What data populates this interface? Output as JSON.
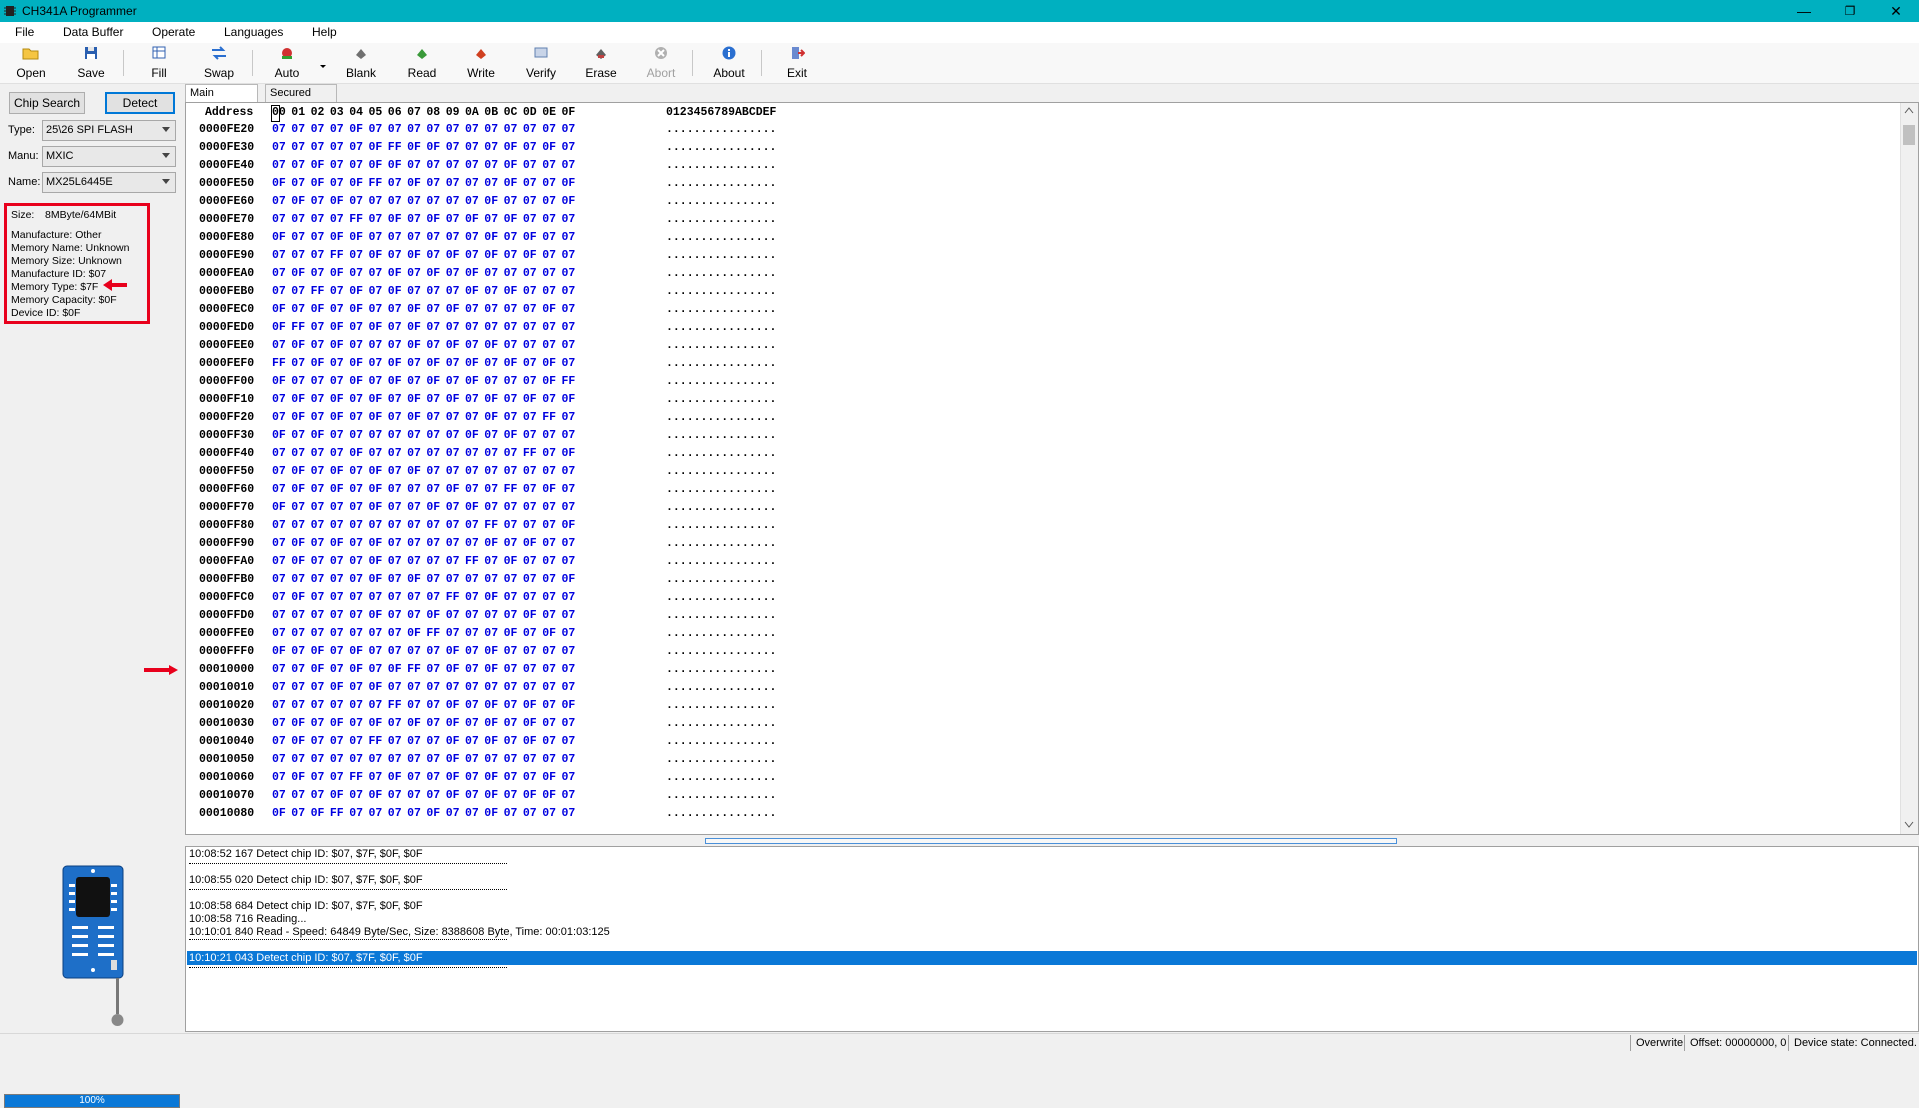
{
  "window": {
    "title": "CH341A Programmer",
    "minimize": "—",
    "maximize": "❐",
    "close": "✕"
  },
  "menu": [
    "File",
    "Data Buffer",
    "Operate",
    "Languages",
    "Help"
  ],
  "toolbar": {
    "open": "Open",
    "save": "Save",
    "fill": "Fill",
    "swap": "Swap",
    "auto": "Auto",
    "blank": "Blank",
    "read": "Read",
    "write": "Write",
    "verify": "Verify",
    "erase": "Erase",
    "abort": "Abort",
    "about": "About",
    "exit": "Exit"
  },
  "left": {
    "chip_search": "Chip Search",
    "detect": "Detect",
    "type_label": "Type:",
    "type_value": "25\\26 SPI FLASH",
    "manu_label": "Manu:",
    "manu_value": "MXIC",
    "name_label": "Name:",
    "name_value": "MX25L6445E",
    "info": {
      "size_label": "Size:",
      "size_value": "8MByte/64MBit",
      "manufacture": "Manufacture: Other",
      "memory_name": "Memory Name: Unknown",
      "memory_size": "Memory Size: Unknown",
      "manufacture_id": "Manufacture ID: $07",
      "memory_type": "Memory Type: $7F",
      "memory_capacity": "Memory Capacity: $0F",
      "device_id": "Device ID: $0F"
    },
    "progress": "100%",
    "progress_value": 100
  },
  "tabs": [
    "Main Memory",
    "Secured OTP"
  ],
  "hex": {
    "address_header": "Address",
    "columns": [
      "00",
      "01",
      "02",
      "03",
      "04",
      "05",
      "06",
      "07",
      "08",
      "09",
      "0A",
      "0B",
      "0C",
      "0D",
      "0E",
      "0F"
    ],
    "ascii_header": "0123456789ABCDEF",
    "ascii_row": "................",
    "rows": [
      {
        "addr": "0000FE20",
        "bytes": "07 07 07 07 0F 07 07 07 07 07 07 07 07 07 07 07"
      },
      {
        "addr": "0000FE30",
        "bytes": "07 07 07 07 07 0F FF 0F 0F 07 07 07 0F 07 0F 07"
      },
      {
        "addr": "0000FE40",
        "bytes": "07 07 0F 07 07 0F 0F 07 07 07 07 07 0F 07 07 07"
      },
      {
        "addr": "0000FE50",
        "bytes": "0F 07 0F 07 0F FF 07 0F 07 07 07 07 0F 07 07 0F"
      },
      {
        "addr": "0000FE60",
        "bytes": "07 0F 07 0F 07 07 07 07 07 07 07 0F 07 07 07 0F"
      },
      {
        "addr": "0000FE70",
        "bytes": "07 07 07 07 FF 07 0F 07 0F 07 0F 07 0F 07 07 07"
      },
      {
        "addr": "0000FE80",
        "bytes": "0F 07 07 0F 0F 07 07 07 07 07 07 0F 07 0F 07 07"
      },
      {
        "addr": "0000FE90",
        "bytes": "07 07 07 FF 07 0F 07 0F 07 0F 07 0F 07 0F 07 07"
      },
      {
        "addr": "0000FEA0",
        "bytes": "07 0F 07 0F 07 07 0F 07 0F 07 0F 07 07 07 07 07"
      },
      {
        "addr": "0000FEB0",
        "bytes": "07 07 FF 07 0F 07 0F 07 07 07 0F 07 0F 07 07 07"
      },
      {
        "addr": "0000FEC0",
        "bytes": "0F 07 0F 07 0F 07 07 0F 07 0F 07 07 07 07 0F 07"
      },
      {
        "addr": "0000FED0",
        "bytes": "0F FF 07 0F 07 0F 07 0F 07 07 07 07 07 07 07 07"
      },
      {
        "addr": "0000FEE0",
        "bytes": "07 0F 07 0F 07 07 07 0F 07 0F 07 0F 07 07 07 07"
      },
      {
        "addr": "0000FEF0",
        "bytes": "FF 07 0F 07 0F 07 0F 07 0F 07 0F 07 0F 07 0F 07"
      },
      {
        "addr": "0000FF00",
        "bytes": "0F 07 07 07 0F 07 0F 07 0F 07 0F 07 07 07 0F FF"
      },
      {
        "addr": "0000FF10",
        "bytes": "07 0F 07 0F 07 0F 07 0F 07 0F 07 0F 07 0F 07 0F"
      },
      {
        "addr": "0000FF20",
        "bytes": "07 0F 07 0F 07 0F 07 0F 07 07 07 0F 07 07 FF 07"
      },
      {
        "addr": "0000FF30",
        "bytes": "0F 07 0F 07 07 07 07 07 07 07 0F 07 0F 07 07 07"
      },
      {
        "addr": "0000FF40",
        "bytes": "07 07 07 07 0F 07 07 07 07 07 07 07 07 FF 07 0F"
      },
      {
        "addr": "0000FF50",
        "bytes": "07 0F 07 0F 07 0F 07 0F 07 07 07 07 07 07 07 07"
      },
      {
        "addr": "0000FF60",
        "bytes": "07 0F 07 0F 07 0F 07 07 07 0F 07 07 FF 07 0F 07"
      },
      {
        "addr": "0000FF70",
        "bytes": "0F 07 07 07 07 0F 07 07 0F 07 0F 07 07 07 07 07"
      },
      {
        "addr": "0000FF80",
        "bytes": "07 07 07 07 07 07 07 07 07 07 07 FF 07 07 07 0F"
      },
      {
        "addr": "0000FF90",
        "bytes": "07 0F 07 0F 07 0F 07 07 07 07 07 0F 07 0F 07 07"
      },
      {
        "addr": "0000FFA0",
        "bytes": "07 0F 07 07 07 0F 07 07 07 07 FF 07 0F 07 07 07"
      },
      {
        "addr": "0000FFB0",
        "bytes": "07 07 07 07 07 0F 07 0F 07 07 07 07 07 07 07 0F"
      },
      {
        "addr": "0000FFC0",
        "bytes": "07 0F 07 07 07 07 07 07 07 FF 07 0F 07 07 07 07"
      },
      {
        "addr": "0000FFD0",
        "bytes": "07 07 07 07 07 0F 07 07 0F 07 07 07 07 0F 07 07"
      },
      {
        "addr": "0000FFE0",
        "bytes": "07 07 07 07 07 07 07 0F FF 07 07 07 0F 07 0F 07"
      },
      {
        "addr": "0000FFF0",
        "bytes": "0F 07 0F 07 0F 07 07 07 07 0F 07 0F 07 07 07 07"
      },
      {
        "addr": "00010000",
        "bytes": "07 07 0F 07 0F 07 0F FF 07 0F 07 0F 07 07 07 07"
      },
      {
        "addr": "00010010",
        "bytes": "07 07 07 0F 07 0F 07 07 07 07 07 07 07 07 07 07"
      },
      {
        "addr": "00010020",
        "bytes": "07 07 07 07 07 07 FF 07 07 0F 07 0F 07 0F 07 0F"
      },
      {
        "addr": "00010030",
        "bytes": "07 0F 07 0F 07 0F 07 0F 07 0F 07 0F 07 0F 07 07"
      },
      {
        "addr": "00010040",
        "bytes": "07 0F 07 07 07 FF 07 07 07 0F 07 0F 07 0F 07 07"
      },
      {
        "addr": "00010050",
        "bytes": "07 07 07 07 07 07 07 07 07 0F 07 07 07 07 07 07"
      },
      {
        "addr": "00010060",
        "bytes": "07 0F 07 07 FF 07 0F 07 07 0F 07 0F 07 07 0F 07"
      },
      {
        "addr": "00010070",
        "bytes": "07 07 07 0F 07 0F 07 07 07 0F 07 0F 07 0F 0F 07"
      },
      {
        "addr": "00010080",
        "bytes": "0F 07 0F FF 07 07 07 07 0F 07 07 0F 07 07 07 07"
      }
    ]
  },
  "log": [
    {
      "text": "10:08:52 167 Detect chip ID: $07, $7F, $0F, $0F",
      "selected": false
    },
    {
      "text": "10:08:55 020 Detect chip ID: $07, $7F, $0F, $0F",
      "selected": false
    },
    {
      "text": "10:08:58 684 Detect chip ID: $07, $7F, $0F, $0F",
      "selected": false
    },
    {
      "text": "10:08:58 716 Reading...",
      "selected": false
    },
    {
      "text": "10:10:01 840 Read - Speed: 64849 Byte/Sec, Size: 8388608 Byte, Time: 00:01:03:125",
      "selected": false
    },
    {
      "text": "10:10:21 043 Detect chip ID: $07, $7F, $0F, $0F",
      "selected": true
    }
  ],
  "status": {
    "mode": "Overwrite",
    "offset": "Offset: 00000000, 0",
    "device_state": "Device state: Connected."
  },
  "colors": {
    "titlebar": "#00b0c0",
    "hex_bytes": "#0000e0",
    "highlight": "#e8001c",
    "selection": "#0a78d7"
  }
}
